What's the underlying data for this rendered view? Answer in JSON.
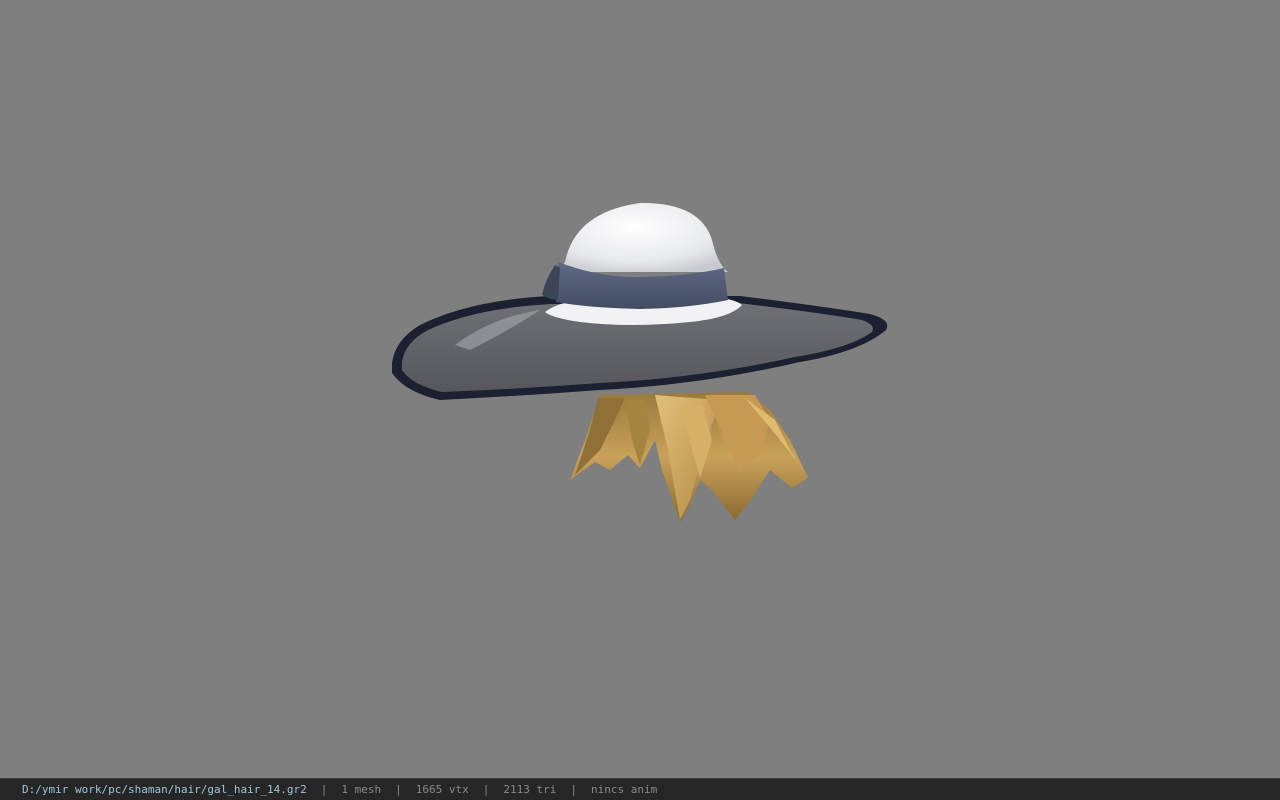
{
  "viewport": {
    "background_color": "#7f7f7f",
    "model_name": "hat-with-hair-model"
  },
  "statusbar": {
    "file_path": "D:/ymir work/pc/shaman/hair/gal_hair_14.gr2",
    "separator": "|",
    "mesh_count": "1 mesh",
    "vertex_count": "1665 vtx",
    "triangle_count": "2113 tri",
    "animation_status": "nincs anim",
    "path_color": "#9fc4d8",
    "text_color": "#8a8a8a"
  }
}
